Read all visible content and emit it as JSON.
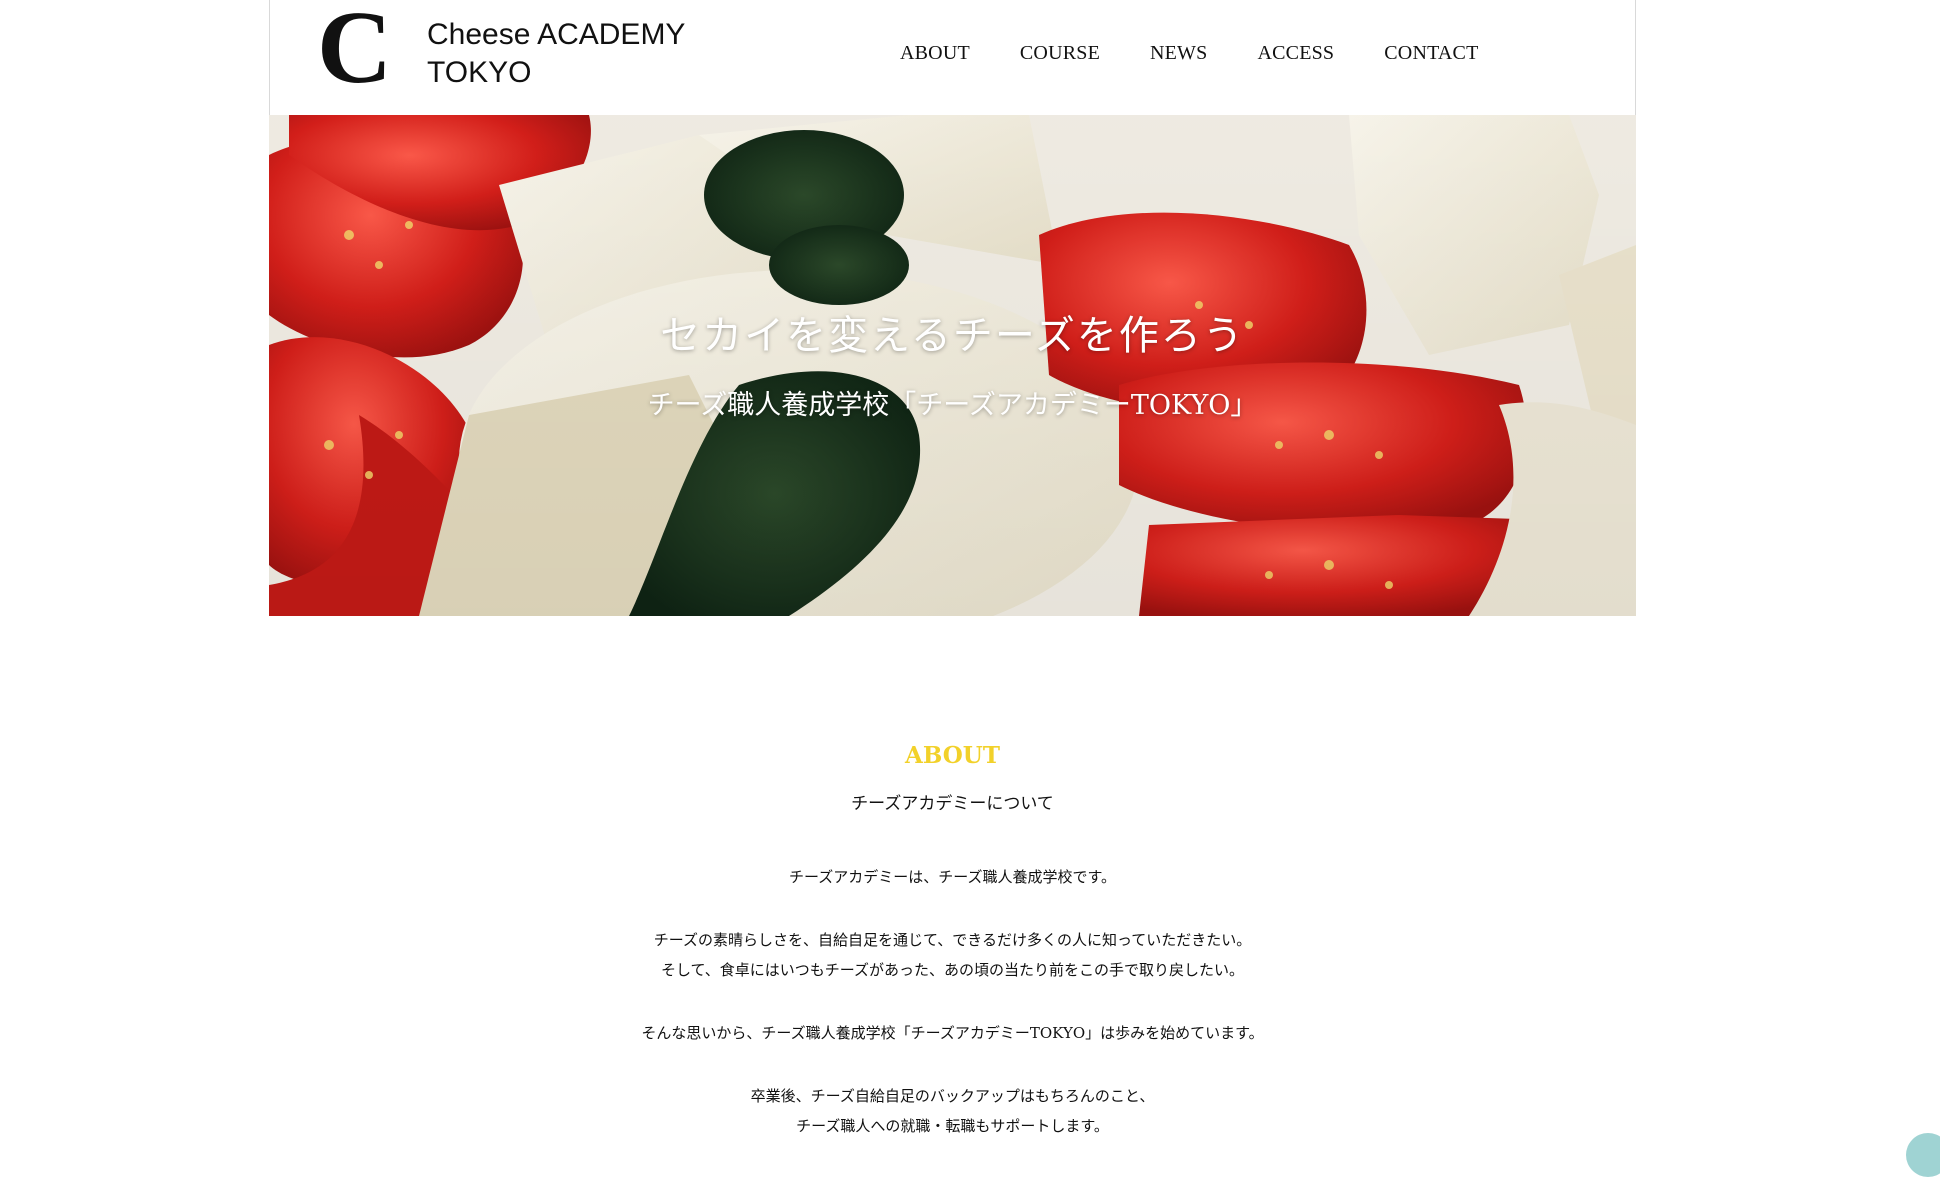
{
  "header": {
    "logo_mark": "C",
    "logo_line1": "Cheese ACADEMY",
    "logo_line2": "TOKYO",
    "nav": [
      "ABOUT",
      "COURSE",
      "NEWS",
      "ACCESS",
      "CONTACT"
    ]
  },
  "hero": {
    "title": "セカイを変えるチーズを作ろう",
    "subtitle": "チーズ職人養成学校「チーズアカデミーTOKYO」"
  },
  "about": {
    "heading": "ABOUT",
    "subheading": "チーズアカデミーについて",
    "paragraphs": [
      [
        "チーズアカデミーは、チーズ職人養成学校です。"
      ],
      [
        "チーズの素晴らしさを、自給自足を通じて、できるだけ多くの人に知っていただきたい。",
        "そして、食卓にはいつもチーズがあった、あの頃の当たり前をこの手で取り戻したい。"
      ],
      [
        "そんな思いから、チーズ職人養成学校「チーズアカデミーTOKYO」は歩みを始めています。"
      ],
      [
        "卒業後、チーズ自給自足のバックアップはもちろんのこと、",
        "チーズ職人への就職・転職もサポートします。"
      ]
    ],
    "accent_color": "#f2d12a"
  },
  "icons": {
    "scroll_top": "scroll-top-icon"
  }
}
